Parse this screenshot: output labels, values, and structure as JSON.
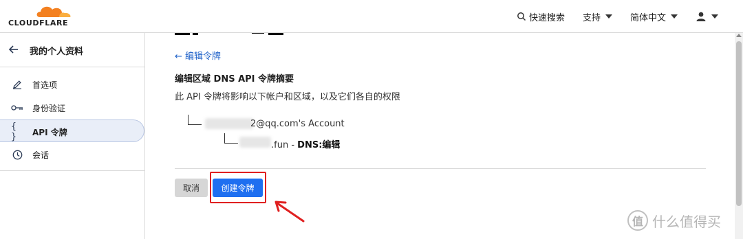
{
  "brand": {
    "logo_text": "CLOUDFLARE",
    "accent": "#f38020"
  },
  "header": {
    "search_label": "快速搜索",
    "support_label": "支持",
    "language_label": "简体中文"
  },
  "sidebar": {
    "back_title": "我的个人资料",
    "items": [
      {
        "label": "首选项",
        "icon": "pencil-icon"
      },
      {
        "label": "身份验证",
        "icon": "key-icon"
      },
      {
        "label": "API 令牌",
        "icon": "braces-icon",
        "active": true
      },
      {
        "label": "会话",
        "icon": "clock-icon"
      }
    ]
  },
  "main": {
    "back_link": "编辑令牌",
    "summary_title": "编辑区域 DNS API 令牌摘要",
    "summary_desc": "此 API 令牌将影响以下帐户和区域，以及它们各自的权限",
    "account_text": "2@qq.com's Account",
    "zone_text": ".fun - ",
    "zone_perm": "DNS:编辑",
    "cancel_label": "取消",
    "create_label": "创建令牌"
  },
  "watermark": {
    "text": "什么值得买",
    "mark": "值"
  },
  "colors": {
    "primary": "#1e6ff0",
    "highlight": "#e02020",
    "link": "#1b5fc8"
  }
}
